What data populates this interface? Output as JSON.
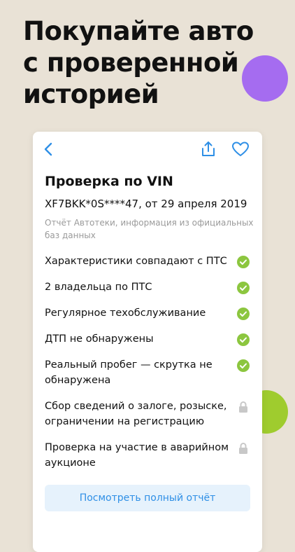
{
  "headline": {
    "lines": [
      "Покупайте авто",
      "с проверенной",
      "историей"
    ]
  },
  "card": {
    "title": "Проверка по VIN",
    "vin_line": "XF7BKK*0S****47, от 29 апреля 2019",
    "source": "Отчёт Автотеки, информация из официальных баз данных",
    "checks": [
      {
        "label": "Характеристики совпадают с ПТС",
        "status": "ok"
      },
      {
        "label": "2 владельца по ПТС",
        "status": "ok"
      },
      {
        "label": "Регулярное техобслуживание",
        "status": "ok"
      },
      {
        "label": "ДТП не обнаружены",
        "status": "ok"
      },
      {
        "label": "Реальный пробег — скрутка не обнаружена",
        "status": "ok"
      },
      {
        "label": "Сбор сведений о залоге, розыске, ограничении на регистрацию",
        "status": "locked"
      },
      {
        "label": "Проверка на участие в аварийном аукционе",
        "status": "locked"
      }
    ],
    "cta_label": "Посмотреть полный отчёт"
  },
  "colors": {
    "background": "#e9e2d6",
    "accent_blue": "#2e8fe6",
    "check_green": "#8cc63f",
    "lock_gray": "#c8c8c8",
    "circle_purple": "#a56cf0",
    "circle_green": "#9fcc2e"
  },
  "icons": {
    "back": "chevron-left-icon",
    "share": "share-icon",
    "favorite": "heart-icon",
    "ok": "check-circle-icon",
    "locked": "lock-icon"
  }
}
